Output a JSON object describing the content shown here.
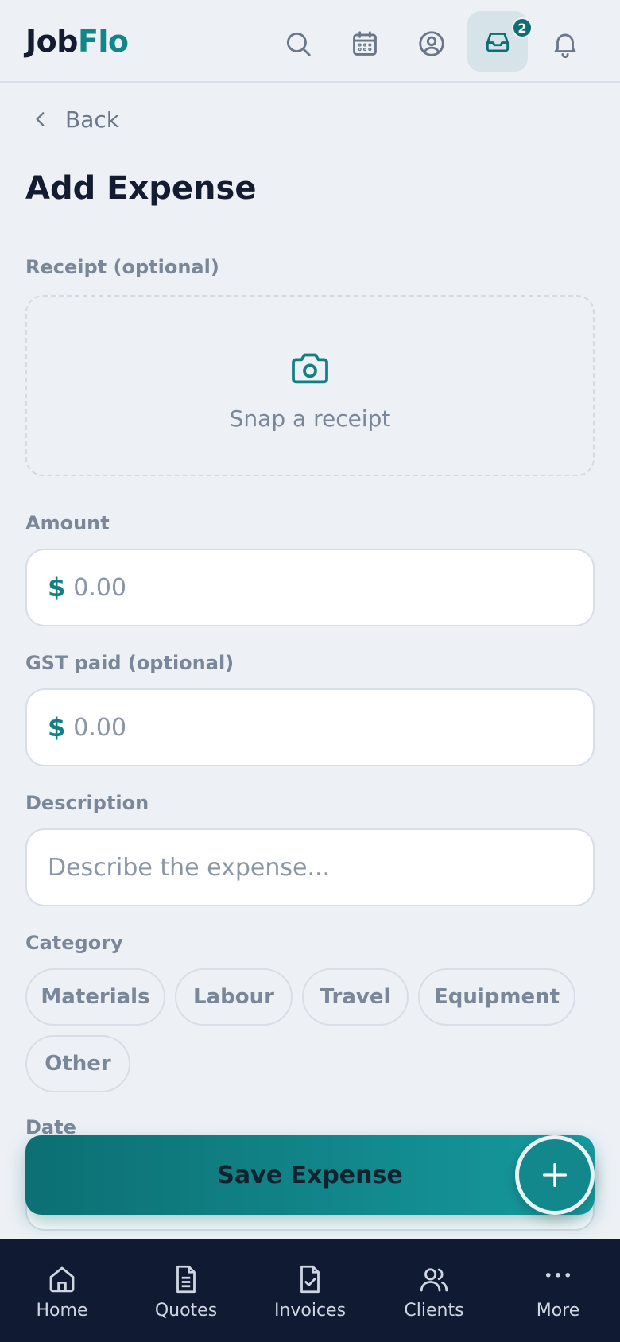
{
  "app": {
    "logo_part1": "Job",
    "logo_part2": "Flo"
  },
  "header": {
    "icons": [
      "search-icon",
      "calendar-icon",
      "user-circle-icon",
      "inbox-icon",
      "bell-icon"
    ],
    "inbox_badge": "2"
  },
  "nav_back": {
    "label": "Back"
  },
  "page": {
    "title": "Add Expense"
  },
  "receipt": {
    "label": "Receipt (optional)",
    "action": "Snap a receipt"
  },
  "amount": {
    "label": "Amount",
    "currency": "$",
    "placeholder": "0.00"
  },
  "gst": {
    "label": "GST paid (optional)",
    "currency": "$",
    "placeholder": "0.00"
  },
  "description": {
    "label": "Description",
    "placeholder": "Describe the expense..."
  },
  "category": {
    "label": "Category",
    "options": [
      "Materials",
      "Labour",
      "Travel",
      "Equipment",
      "Other"
    ]
  },
  "date": {
    "label": "Date"
  },
  "save_button": {
    "label": "Save Expense"
  },
  "bottom_nav": {
    "items": [
      {
        "label": "Home",
        "icon": "home-icon"
      },
      {
        "label": "Quotes",
        "icon": "document-icon"
      },
      {
        "label": "Invoices",
        "icon": "invoice-check-icon"
      },
      {
        "label": "Clients",
        "icon": "users-icon"
      },
      {
        "label": "More",
        "icon": "more-dots-icon"
      }
    ]
  },
  "colors": {
    "accent": "#12878a",
    "nav_bg": "#101b33",
    "page_bg": "#edf1f6"
  }
}
